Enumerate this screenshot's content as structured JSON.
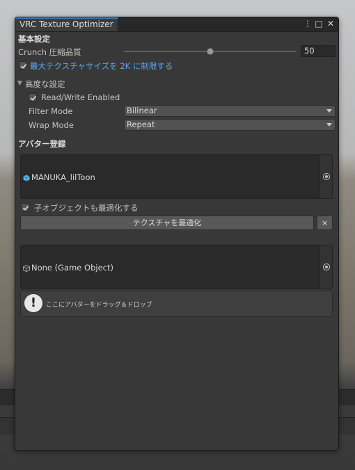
{
  "window": {
    "tab_title": "VRC Texture Optimizer",
    "menu_glyph": "⋮",
    "maximize_glyph": "□",
    "close_glyph": "✕"
  },
  "basic": {
    "section_label": "基本設定",
    "crunch_label": "Crunch 圧縮品質",
    "crunch_value": "50",
    "crunch_fraction": 0.5,
    "maxsize_label": "最大テクスチャサイズを 2K に制限する",
    "maxsize_checked": true
  },
  "advanced": {
    "section_label": "高度な設定",
    "foldout_glyph": "▼",
    "readwrite_label": "Read/Write Enabled",
    "readwrite_checked": true,
    "filter_label": "Filter Mode",
    "filter_value": "Bilinear",
    "wrap_label": "Wrap Mode",
    "wrap_value": "Repeat"
  },
  "avatar": {
    "section_label": "アバター登録",
    "avatar1_name": "MANUKA_lilToon",
    "include_children_label": "子オブジェクトも最適化する",
    "include_children_checked": true,
    "optimize_button": "テクスチャを最適化",
    "remove_button": "×",
    "avatar2_name": "None (Game Object)",
    "drop_hint": "ここにアバターをドラッグ＆ドロップ",
    "help_glyph": "!"
  },
  "colors": {
    "tab_accent": "#3a79bb",
    "link_blue": "#5aa7f0",
    "window_bg": "#383838"
  }
}
